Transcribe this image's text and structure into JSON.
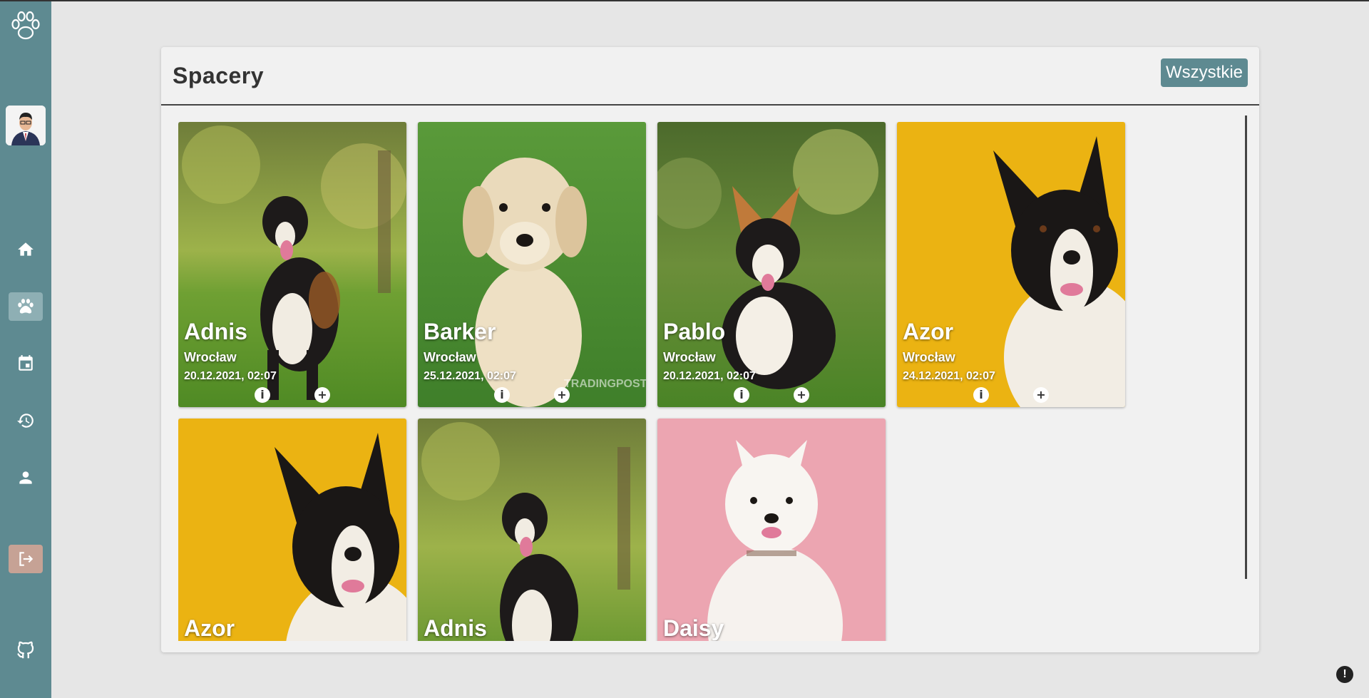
{
  "page": {
    "title": "Spacery",
    "all_button": "Wszystkie"
  },
  "sidebar": {
    "items": [
      {
        "icon": "home-icon",
        "active": false
      },
      {
        "icon": "paw-icon",
        "active": true
      },
      {
        "icon": "calendar-icon",
        "active": false
      },
      {
        "icon": "history-icon",
        "active": false
      },
      {
        "icon": "person-icon",
        "active": false
      }
    ],
    "logout_icon": "logout-icon",
    "github_icon": "github-icon"
  },
  "colors": {
    "sidebar": "#5e8a91",
    "active_item": "#8eafb4",
    "logout": "#c6a295",
    "accent_button": "#5e8a91"
  },
  "walks": [
    {
      "name": "Adnis",
      "city": "Wrocław",
      "date": "20.12.2021, 02:07",
      "photo": "tricolor-aussie-on-grass"
    },
    {
      "name": "Barker",
      "city": "Wrocław",
      "date": "25.12.2021, 02:07",
      "photo": "golden-puppy-on-grass"
    },
    {
      "name": "Pablo",
      "city": "Wrocław",
      "date": "20.12.2021, 02:07",
      "photo": "corgi-on-grass"
    },
    {
      "name": "Azor",
      "city": "Wrocław",
      "date": "24.12.2021, 02:07",
      "photo": "border-collie-on-yellow"
    },
    {
      "name": "Azor",
      "city": "",
      "date": "",
      "photo": "border-collie-on-yellow"
    },
    {
      "name": "Adnis",
      "city": "",
      "date": "",
      "photo": "tricolor-aussie-on-grass"
    },
    {
      "name": "Daisy",
      "city": "",
      "date": "",
      "photo": "samoyed-on-pink"
    }
  ]
}
